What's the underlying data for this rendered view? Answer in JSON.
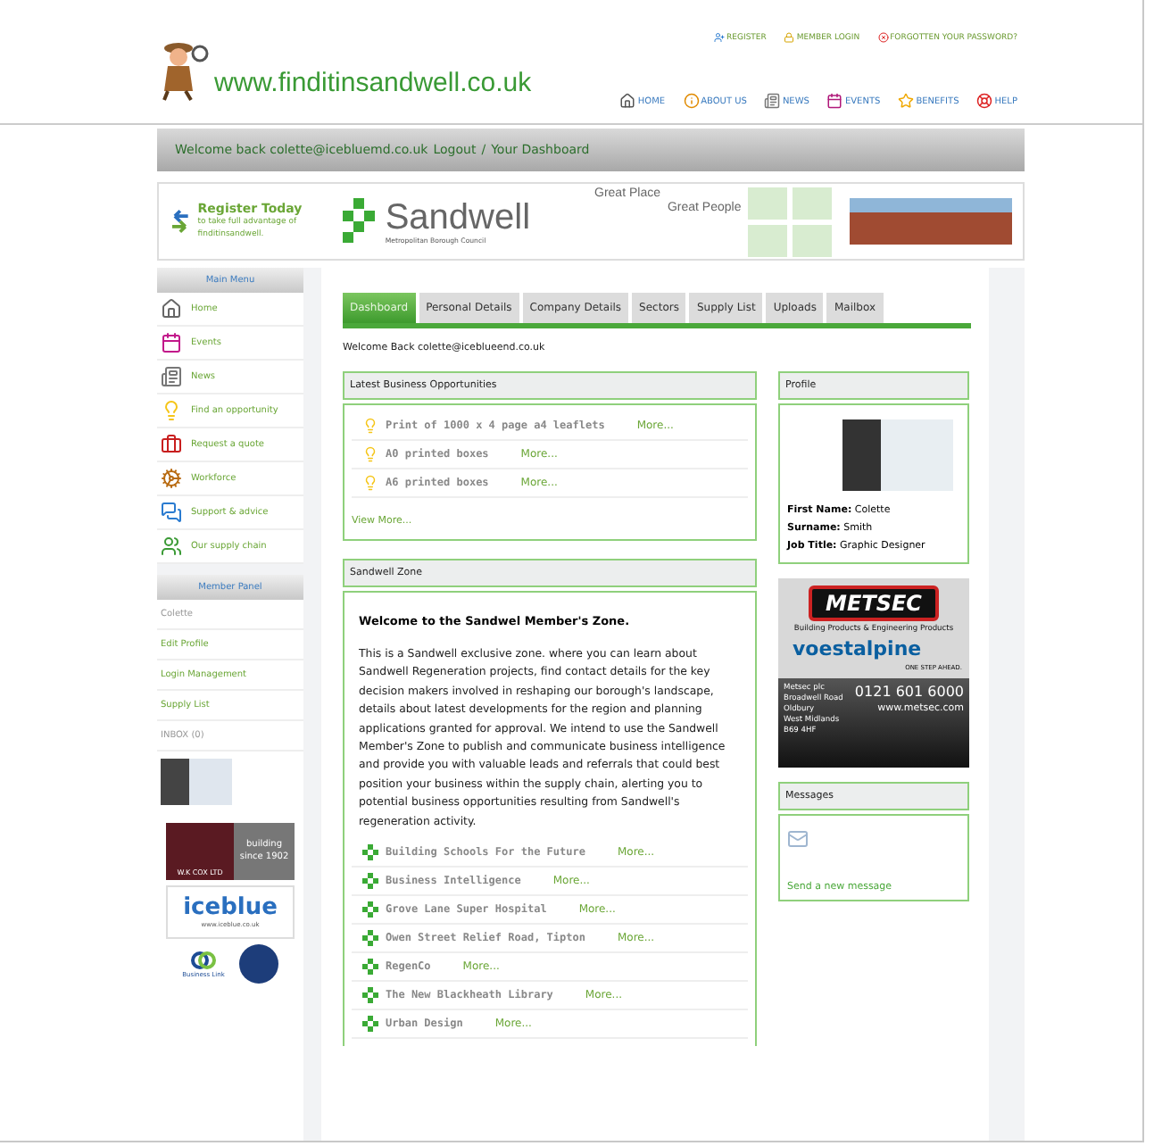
{
  "header": {
    "logo_text": "www.finditinsandwell.co.uk",
    "top_links": [
      {
        "label": "REGISTER"
      },
      {
        "label": "MEMBER LOGIN"
      },
      {
        "label": "FORGOTTEN YOUR PASSWORD?"
      }
    ],
    "nav": [
      {
        "label": "HOME"
      },
      {
        "label": "ABOUT US"
      },
      {
        "label": "NEWS"
      },
      {
        "label": "EVENTS"
      },
      {
        "label": "BENEFITS"
      },
      {
        "label": "HELP"
      }
    ]
  },
  "welcome_bar": {
    "greeting": "Welcome back colette@icebluemd.co.uk",
    "logout": "Logout",
    "separator": "/",
    "dashboard": "Your Dashboard"
  },
  "banner": {
    "register_title": "Register Today",
    "register_text": "to take full advantage of finditinsandwell.",
    "council_name": "Sandwell",
    "council_sub": "Metropolitan Borough Council",
    "slogans": [
      "Great Place",
      "Great People"
    ]
  },
  "sidebar": {
    "main_menu": {
      "title": "Main Menu",
      "items": [
        {
          "label": "Home"
        },
        {
          "label": "Events"
        },
        {
          "label": "News"
        },
        {
          "label": "Find an opportunity"
        },
        {
          "label": "Request a quote"
        },
        {
          "label": "Workforce"
        },
        {
          "label": "Support & advice"
        },
        {
          "label": "Our supply chain"
        }
      ]
    },
    "member_panel": {
      "title": "Member Panel",
      "items": [
        {
          "label": "Colette",
          "kind": "info"
        },
        {
          "label": "Edit Profile",
          "kind": "link"
        },
        {
          "label": "Login Management",
          "kind": "link"
        },
        {
          "label": "Supply List",
          "kind": "link"
        },
        {
          "label": "INBOX (0)",
          "kind": "info"
        }
      ]
    },
    "sponsors": {
      "wkcox_name": "W.K COX LTD",
      "wkcox_text": "building since 1902",
      "iceblue_name": "iceblue",
      "iceblue_url": "www.iceblue.co.uk",
      "business_link": "Business Link"
    }
  },
  "tabs": [
    {
      "label": "Dashboard",
      "selected": true
    },
    {
      "label": "Personal Details",
      "selected": false
    },
    {
      "label": "Company Details",
      "selected": false
    },
    {
      "label": "Sectors",
      "selected": false
    },
    {
      "label": "Supply List",
      "selected": false
    },
    {
      "label": "Uploads",
      "selected": false
    },
    {
      "label": "Mailbox",
      "selected": false
    }
  ],
  "welcome": "Welcome Back colette@iceblueend.co.uk",
  "opportunities": {
    "title": "Latest Business Opportunities",
    "items": [
      {
        "title": "Print of 1000 x 4 page a4 leaflets",
        "more": "More..."
      },
      {
        "title": "A0 printed boxes",
        "more": "More..."
      },
      {
        "title": "A6 printed boxes",
        "more": "More..."
      }
    ],
    "view_more": "View More..."
  },
  "zone": {
    "title": "Sandwell Zone",
    "heading": "Welcome to the Sandwel Member's Zone.",
    "body": "This is a Sandwell exclusive zone. where you can learn about Sandwell Regeneration projects, find contact details for the key decision makers involved in reshaping our borough's landscape, details about latest developments for the region and planning applications granted for approval. We intend to use the Sandwell Member's Zone to publish and communicate business intelligence and provide you with valuable leads and referrals that could best position your business within the supply chain, alerting you to potential business opportunities resulting from Sandwell's regeneration activity.",
    "items": [
      {
        "title": "Building Schools For the Future",
        "more": "More..."
      },
      {
        "title": "Business Intelligence",
        "more": "More..."
      },
      {
        "title": "Grove Lane Super Hospital",
        "more": "More..."
      },
      {
        "title": "Owen Street Relief Road, Tipton",
        "more": "More..."
      },
      {
        "title": "RegenCo",
        "more": "More..."
      },
      {
        "title": "The New Blackheath Library",
        "more": "More..."
      },
      {
        "title": "Urban Design",
        "more": "More..."
      }
    ]
  },
  "profile": {
    "title": "Profile",
    "fields": [
      {
        "label": "First Name:",
        "value": "Colette"
      },
      {
        "label": "Surname:",
        "value": "Smith"
      },
      {
        "label": "Job Title:",
        "value": "Graphic Designer"
      }
    ]
  },
  "ad": {
    "brand": "METSEC",
    "tagline": "Building Products & Engineering Products",
    "partner": "voestalpine",
    "partner_tagline": "ONE STEP AHEAD.",
    "address": [
      "Metsec plc",
      "Broadwell Road",
      "Oldbury",
      "West Midlands",
      "B69 4HF"
    ],
    "phone": "0121 601 6000",
    "web": "www.metsec.com"
  },
  "messages": {
    "title": "Messages",
    "link": "Send a new message"
  }
}
